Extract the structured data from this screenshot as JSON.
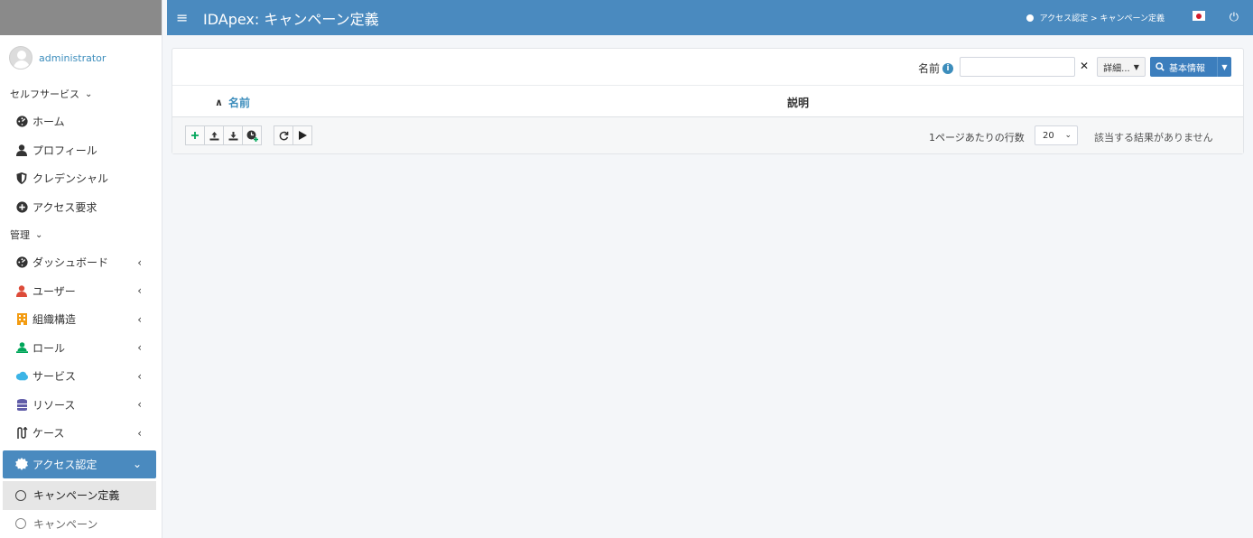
{
  "header": {
    "title": "IDApex: キャンペーン定義",
    "breadcrumb": "アクセス認定 >  キャンペーン定義"
  },
  "user": {
    "name": "administrator"
  },
  "sidebar": {
    "section_self": "セルフサービス",
    "self_items": [
      {
        "label": "ホーム",
        "icon": "dashboard-icon"
      },
      {
        "label": "プロフィール",
        "icon": "user-icon"
      },
      {
        "label": "クレデンシャル",
        "icon": "shield-icon"
      },
      {
        "label": "アクセス要求",
        "icon": "plus-circle-icon"
      }
    ],
    "section_admin": "管理",
    "admin_items": [
      {
        "label": "ダッシュボード",
        "icon": "dashboard-icon",
        "color": "#333333"
      },
      {
        "label": "ユーザー",
        "icon": "user-icon",
        "color": "#dd4b39"
      },
      {
        "label": "組織構造",
        "icon": "building-icon",
        "color": "#f39c12"
      },
      {
        "label": "ロール",
        "icon": "role-icon",
        "color": "#00a65a"
      },
      {
        "label": "サービス",
        "icon": "cloud-icon",
        "color": "#3cb4e6"
      },
      {
        "label": "リソース",
        "icon": "database-icon",
        "color": "#605ca8"
      },
      {
        "label": "ケース",
        "icon": "route-icon",
        "color": "#333333"
      }
    ],
    "active_item": "アクセス認定",
    "sub_items": [
      {
        "label": "キャンペーン定義"
      },
      {
        "label": "キャンペーン"
      }
    ]
  },
  "search": {
    "label": "名前",
    "value": "",
    "clear": "✕",
    "detail_label": "詳細...",
    "basic_label": "基本情報"
  },
  "table": {
    "columns": [
      "名前",
      "説明"
    ]
  },
  "footer": {
    "rows_label": "1ページあたりの行数",
    "rows_value": "20",
    "no_results": "該当する結果がありません"
  },
  "colors": {
    "header": "#4a8abf",
    "accent": "#3c8dbc",
    "primary_button": "#3c7ebd"
  }
}
